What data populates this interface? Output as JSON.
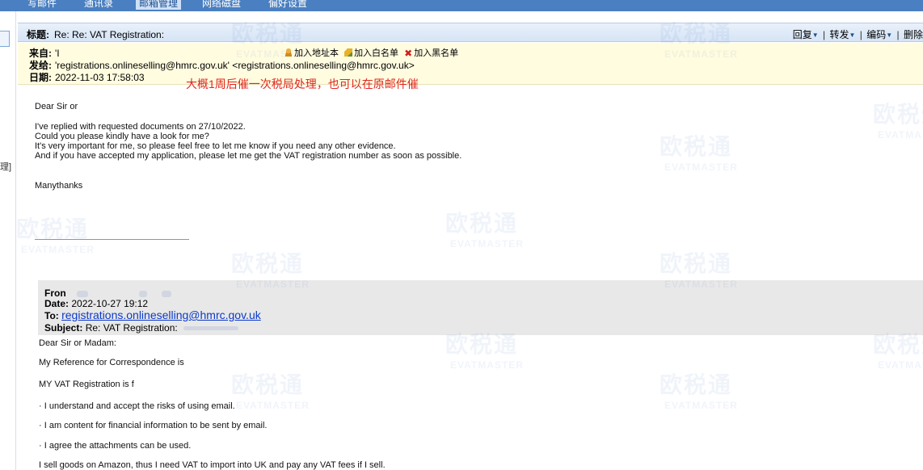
{
  "topnav": {
    "tabs": [
      "写邮件",
      "通讯录",
      "邮箱管理",
      "网络磁盘",
      "偏好设置"
    ]
  },
  "leftstrip": {
    "edge_text": "理]"
  },
  "subject_bar": {
    "label": "标题:",
    "subject": "Re: Re: VAT Registration:",
    "reply": "回复",
    "forward": "转发",
    "encoding": "编码",
    "delete": "删除"
  },
  "header": {
    "from_label": "来自:",
    "from_value": "'I",
    "to_label": "发给:",
    "to_value": "'registrations.onlineselling@hmrc.gov.uk' <registrations.onlineselling@hmrc.gov.uk>",
    "date_label": "日期:",
    "date_value": "2022-11-03 17:58:03",
    "add_contact": "加入地址本",
    "add_whitelist": "加入白名单",
    "add_blacklist": "加入黑名单"
  },
  "annotation": "大概1周后催一次税局处理，也可以在原邮件催",
  "message": {
    "greeting": "Dear Sir or",
    "lines": [
      "I've replied with requested documents on 27/10/2022.",
      "Could you please kindly have a look for me?",
      "It's very important for me, so please feel free to let me know if you need any other evidence.",
      "And if you have accepted my application, please let me get the VAT registration number as soon as possible."
    ],
    "closing": "Manythanks"
  },
  "quoted": {
    "from_label": "Fron",
    "date_label": "Date:",
    "date_value": "2022-10-27 19:12",
    "to_label": "To:",
    "to_value": "registrations.onlineselling@hmrc.gov.uk",
    "subject_label": "Subject:",
    "subject_value": "Re: VAT Registration:",
    "body": [
      "Dear Sir or Madam:",
      "My Reference for Correspondence is",
      "MY VAT Registration is f",
      "· I understand and accept the risks of using email.",
      "· I am content for financial information to be sent by email.",
      "· I agree the attachments can be used.",
      "I sell goods on Amazon, thus I need VAT to import into UK and pay any VAT fees if I sell."
    ]
  },
  "watermark": {
    "cn": "欧税通",
    "en": "EVATMASTER"
  }
}
